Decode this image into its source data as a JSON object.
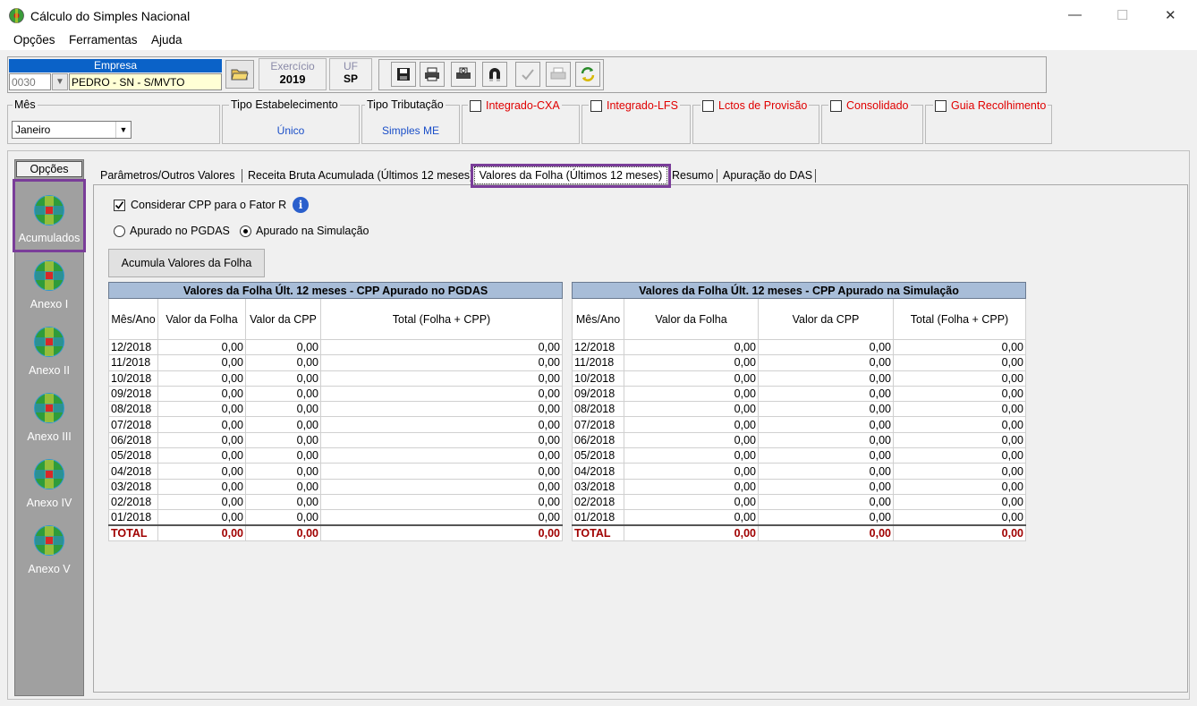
{
  "window": {
    "title": "Cálculo do Simples Nacional",
    "minimize": "—",
    "maximize": "☐",
    "close": "✕"
  },
  "menu": [
    "Opções",
    "Ferramentas",
    "Ajuda"
  ],
  "empresa": {
    "label": "Empresa",
    "code": "0030",
    "name": "PEDRO - SN - S/MVTO"
  },
  "exercicio": {
    "label": "Exercício",
    "value": "2019"
  },
  "uf": {
    "label": "UF",
    "value": "SP"
  },
  "mes": {
    "label": "Mês",
    "value": "Janeiro"
  },
  "tipo_estabelecimento": {
    "label": "Tipo Estabelecimento",
    "value": "Único"
  },
  "tipo_tributacao": {
    "label": "Tipo Tributação",
    "value": "Simples ME"
  },
  "flags": [
    {
      "label": "Integrado-CXA",
      "checked": false
    },
    {
      "label": "Integrado-LFS",
      "checked": false
    },
    {
      "label": "Lctos de Provisão",
      "checked": false
    },
    {
      "label": "Consolidado",
      "checked": false
    },
    {
      "label": "Guia Recolhimento",
      "checked": false
    }
  ],
  "sidebar": {
    "header": "Opções",
    "items": [
      "Acumulados",
      "Anexo I",
      "Anexo II",
      "Anexo III",
      "Anexo IV",
      "Anexo V"
    ]
  },
  "tabs": [
    "Parâmetros/Outros Valores",
    "Receita Bruta Acumulada (Últimos 12 meses)",
    "Valores da Folha (Últimos 12 meses)",
    "Resumo",
    "Apuração do DAS"
  ],
  "options": {
    "considerar_cpp": "Considerar CPP para o Fator R",
    "radio_pgdas": "Apurado no PGDAS",
    "radio_simulacao": "Apurado na Simulação",
    "acumula_button": "Acumula Valores da Folha"
  },
  "table_left": {
    "title": "Valores da Folha Últ. 12 meses - CPP Apurado no PGDAS",
    "columns": [
      "Mês/Ano",
      "Valor da Folha",
      "Valor da CPP",
      "Total (Folha + CPP)"
    ]
  },
  "table_right": {
    "title": "Valores da Folha Últ. 12 meses - CPP Apurado na Simulação",
    "columns": [
      "Mês/Ano",
      "Valor da Folha",
      "Valor da CPP",
      "Total (Folha + CPP)"
    ]
  },
  "months": [
    "12/2018",
    "11/2018",
    "10/2018",
    "09/2018",
    "08/2018",
    "07/2018",
    "06/2018",
    "05/2018",
    "04/2018",
    "03/2018",
    "02/2018",
    "01/2018"
  ],
  "zero": "0,00",
  "total_label": "TOTAL"
}
